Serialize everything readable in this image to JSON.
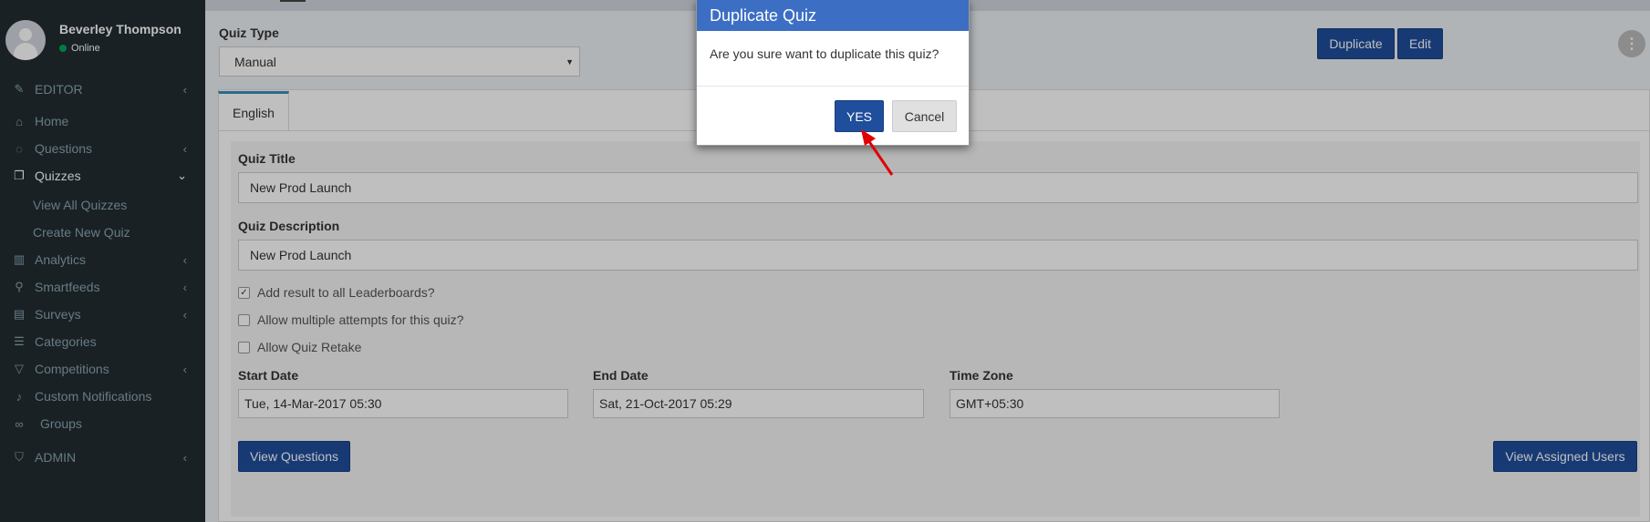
{
  "user": {
    "name": "Beverley Thompson",
    "status": "Online"
  },
  "sidebar": {
    "items": [
      {
        "label": "EDITOR",
        "icon": "edit-icon",
        "chevron": "‹"
      },
      {
        "label": "Home",
        "icon": "home-icon"
      },
      {
        "label": "Questions",
        "icon": "comment-icon",
        "chevron": "‹"
      },
      {
        "label": "Quizzes",
        "icon": "copy-icon",
        "chevron": "⌄"
      },
      {
        "label": "View All Quizzes"
      },
      {
        "label": "Create New Quiz"
      },
      {
        "label": "Analytics",
        "icon": "bar-chart-icon",
        "chevron": "‹"
      },
      {
        "label": "Smartfeeds",
        "icon": "rss-icon",
        "chevron": "‹"
      },
      {
        "label": "Surveys",
        "icon": "clipboard-icon",
        "chevron": "‹"
      },
      {
        "label": "Categories",
        "icon": "list-icon"
      },
      {
        "label": "Competitions",
        "icon": "trophy-icon",
        "chevron": "‹"
      },
      {
        "label": "Custom Notifications",
        "icon": "bell-icon"
      },
      {
        "label": "Groups",
        "icon": "link-icon"
      },
      {
        "label": "ADMIN",
        "icon": "shield-icon",
        "chevron": "‹"
      }
    ]
  },
  "header": {
    "quiz_type_label": "Quiz Type",
    "quiz_type_value": "Manual",
    "duplicate_label": "Duplicate",
    "edit_label": "Edit",
    "kebab": "⋮"
  },
  "tabs": [
    {
      "label": "English"
    }
  ],
  "form": {
    "title_label": "Quiz Title",
    "title_value": "New Prod Launch",
    "description_label": "Quiz Description",
    "description_value": "New Prod Launch",
    "checkboxes": [
      {
        "label": "Add result to all Leaderboards?",
        "checked": true
      },
      {
        "label": "Allow multiple attempts for this quiz?",
        "checked": false
      },
      {
        "label": "Allow Quiz Retake",
        "checked": false
      }
    ],
    "start_date_label": "Start Date",
    "start_date_value": "Tue, 14-Mar-2017 05:30",
    "end_date_label": "End Date",
    "end_date_value": "Sat, 21-Oct-2017 05:29",
    "timezone_label": "Time Zone",
    "timezone_value": "GMT+05:30",
    "view_questions_label": "View Questions",
    "view_assigned_users_label": "View Assigned Users"
  },
  "modal": {
    "title": "Duplicate Quiz",
    "message": "Are you sure want to duplicate this quiz?",
    "yes_label": "YES",
    "cancel_label": "Cancel"
  },
  "colors": {
    "sidebar_bg": "#222d32",
    "primary": "#1f4e9c",
    "modal_header": "#3c6fc4",
    "online": "#00a65a",
    "arrow": "#e00000"
  }
}
